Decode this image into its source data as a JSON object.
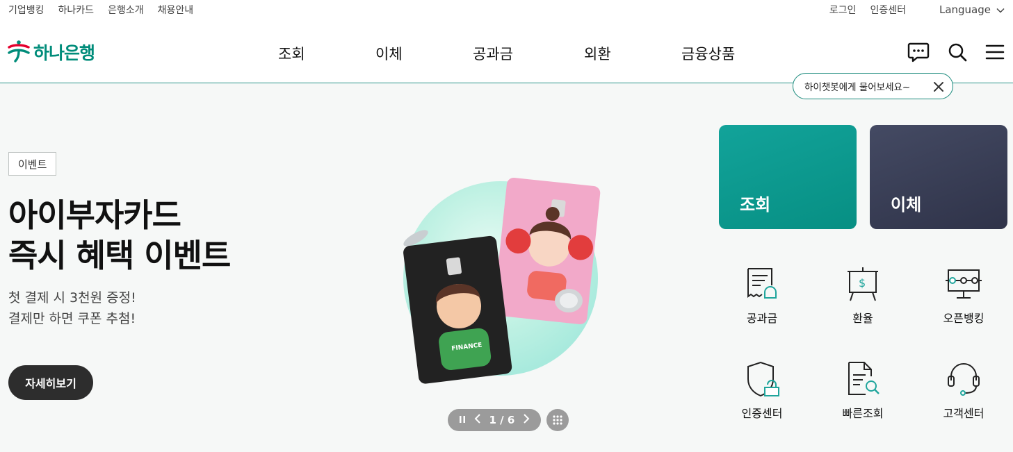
{
  "util": {
    "left_links": [
      "기업뱅킹",
      "하나카드",
      "은행소개",
      "채용안내"
    ],
    "login": "로그인",
    "cert_center": "인증센터",
    "language": "Language"
  },
  "header": {
    "logo_text": "하나은행",
    "nav": [
      "조회",
      "이체",
      "공과금",
      "외환",
      "금융상품"
    ],
    "icons": [
      "chatbot-icon",
      "search-icon",
      "menu-icon"
    ]
  },
  "chat_tip": {
    "text": "하이챗봇에게 물어보세요~"
  },
  "hero": {
    "badge": "이벤트",
    "title_line1": "아이부자카드",
    "title_line2": "즉시 혜택 이벤트",
    "desc_line1": "첫 결제 시 3천원 증정!",
    "desc_line2": "결제만 하면 쿠폰 추첨!",
    "more_button": "자세히보기",
    "pager": "1 / 6",
    "card_text": "FINANCE"
  },
  "quick": {
    "tile1": "조회",
    "tile2": "이체",
    "menu": [
      "공과금",
      "환율",
      "오픈뱅킹",
      "인증센터",
      "빠른조회",
      "고객센터"
    ]
  },
  "colors": {
    "brand": "#008c7a",
    "tile1": "#0a998c",
    "tile2": "#383d55",
    "accent": "#1fa59c"
  }
}
